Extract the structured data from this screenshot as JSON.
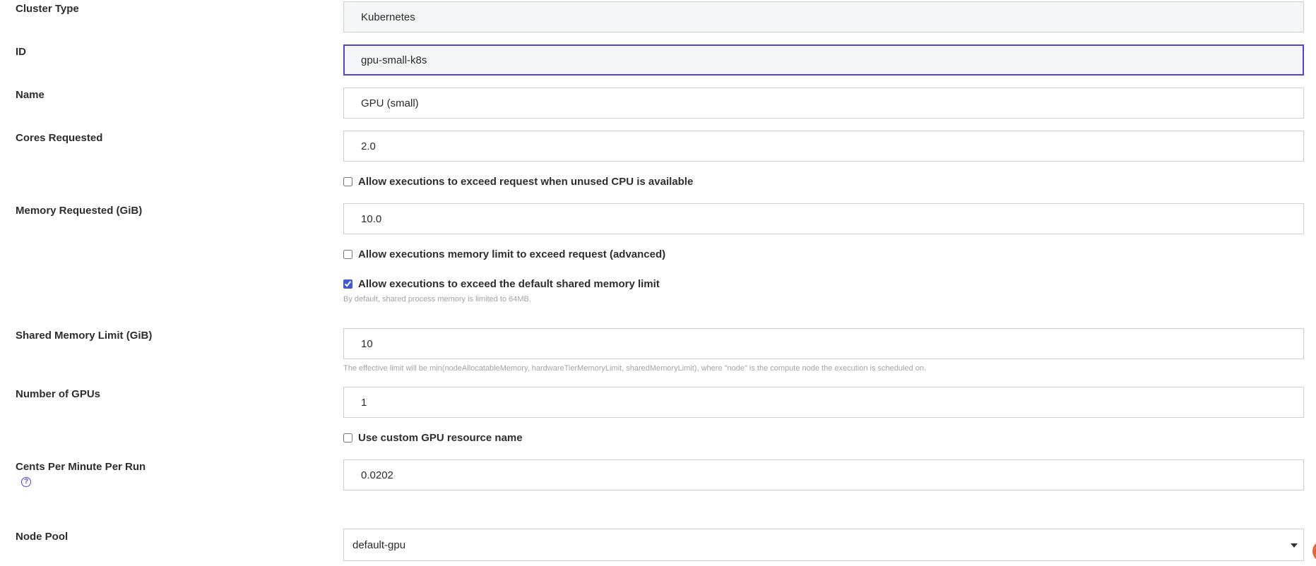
{
  "form": {
    "cluster_type": {
      "label": "Cluster Type",
      "value": "Kubernetes"
    },
    "id": {
      "label": "ID",
      "value": "gpu-small-k8s"
    },
    "name": {
      "label": "Name",
      "value": "GPU (small)"
    },
    "cores": {
      "label": "Cores Requested",
      "value": "2.0",
      "allow_exceed_label": "Allow executions to exceed request when unused CPU is available",
      "allow_exceed_checked": false
    },
    "memory": {
      "label": "Memory Requested (GiB)",
      "value": "10.0",
      "allow_limit_label": "Allow executions memory limit to exceed request (advanced)",
      "allow_limit_checked": false,
      "allow_shared_label": "Allow executions to exceed the default shared memory limit",
      "allow_shared_checked": true,
      "shared_help": "By default, shared process memory is limited to 64MB."
    },
    "shared_memory": {
      "label": "Shared Memory Limit (GiB)",
      "value": "10",
      "help": "The effective limit will be min(nodeAllocatableMemory, hardwareTierMemoryLimit, sharedMemoryLimit), where \"node\" is the compute node the execution is scheduled on."
    },
    "gpus": {
      "label": "Number of GPUs",
      "value": "1",
      "custom_label": "Use custom GPU resource name",
      "custom_checked": false
    },
    "cents": {
      "label": "Cents Per Minute Per Run",
      "value": "0.0202",
      "help_icon": "question-circle-icon",
      "help_glyph": "?"
    },
    "node_pool": {
      "label": "Node Pool",
      "value": "default-gpu"
    }
  },
  "colors": {
    "accent": "#5b3fd6",
    "checkbox": "#3f5bd4",
    "help_text": "#a3a3a3",
    "readonly_bg": "#f4f5f6"
  }
}
